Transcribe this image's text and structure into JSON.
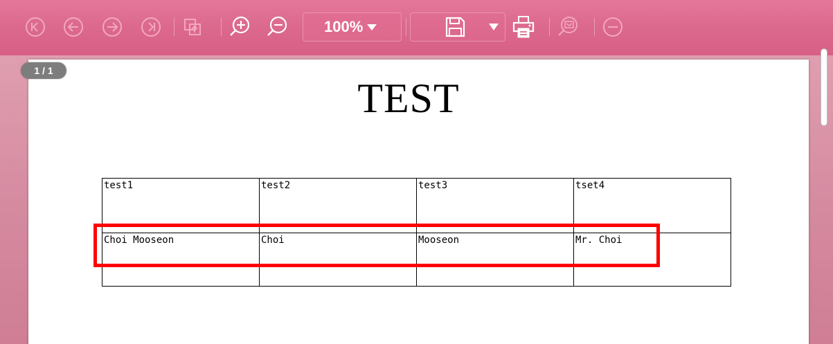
{
  "toolbar": {
    "zoom_value": "100%",
    "icons": {
      "first_page": "first-page-icon",
      "prev_page": "prev-page-icon",
      "next_page": "next-page-icon",
      "last_page": "last-page-icon",
      "export": "export-icon",
      "zoom_in": "zoom-in-icon",
      "zoom_out": "zoom-out-icon",
      "save": "save-icon",
      "print": "print-icon",
      "comment": "comment-icon",
      "close": "minus-circle-icon"
    }
  },
  "document": {
    "page_indicator": "1 / 1",
    "title": "TEST",
    "table": {
      "header": [
        "test1",
        "test2",
        "test3",
        "tset4"
      ],
      "rows": [
        [
          "Choi Mooseon",
          "Choi",
          "Mooseon",
          "Mr. Choi"
        ]
      ]
    }
  },
  "colors": {
    "toolbar": "#dc6a8e",
    "background": "#d58aa0",
    "highlight": "#ff0000"
  }
}
